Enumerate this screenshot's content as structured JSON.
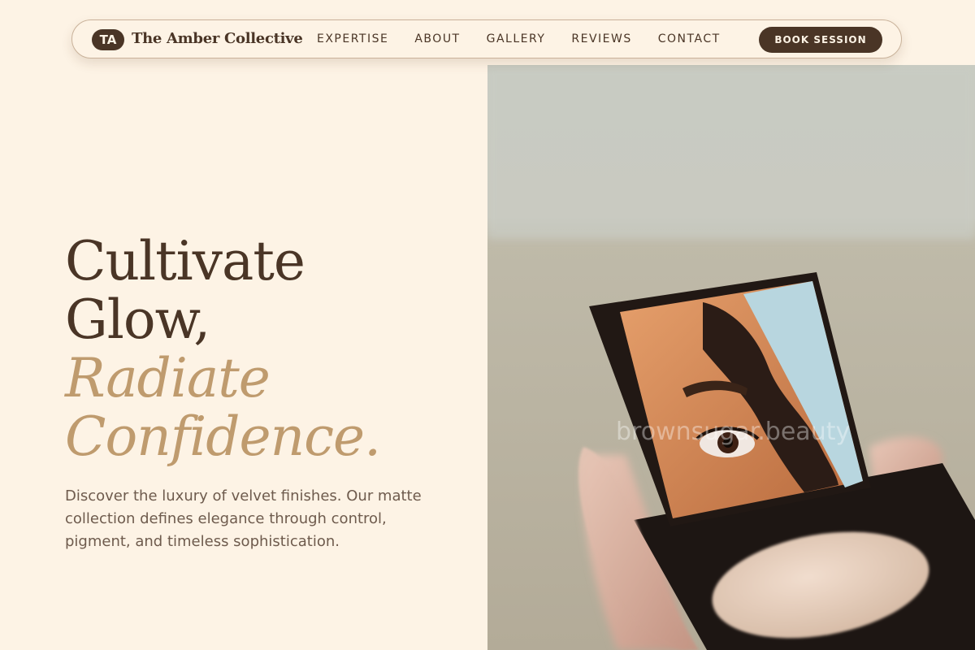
{
  "brand": {
    "initials": "TA",
    "name": "The Amber Collective"
  },
  "nav": {
    "links": [
      "EXPERTISE",
      "ABOUT",
      "GALLERY",
      "REVIEWS",
      "CONTACT"
    ],
    "cta": "BOOK SESSION"
  },
  "hero": {
    "title_lines": [
      "Cultivate",
      "Glow,"
    ],
    "accent_lines": [
      "Radiate",
      "Confidence."
    ],
    "description": "Discover the luxury of velvet finishes. Our matte collection defines elegance through control, pigment, and timeless sophistication."
  },
  "image": {
    "subject": "hand-holding-compact-mirror",
    "watermark": "brownsugar.beauty"
  },
  "colors": {
    "background": "#fdf3e5",
    "primary": "#4a3526",
    "accent": "#bf9b6e",
    "body_text": "#6e5b4d"
  }
}
